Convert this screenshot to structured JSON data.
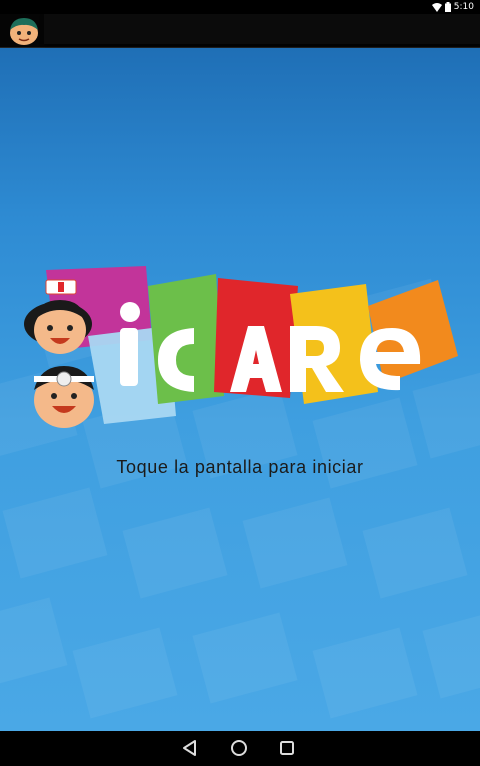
{
  "status_bar": {
    "time": "5:10",
    "icons": [
      "wifi-icon",
      "battery-icon"
    ]
  },
  "app_bar": {
    "avatar_icon": "kid-face-icon"
  },
  "splash": {
    "logo_text": "iCARE",
    "prompt": "Toque la pantalla para iniciar",
    "colors": {
      "background_top": "#1f6fb6",
      "background_bottom": "#4aa8e6",
      "tile_magenta": "#c2349a",
      "tile_green": "#6cbf4a",
      "tile_red": "#e0262b",
      "tile_yellow": "#f4c11b",
      "tile_orange": "#f28a1d"
    }
  },
  "nav_bar": {
    "buttons": [
      "back-icon",
      "home-icon",
      "recents-icon"
    ]
  }
}
